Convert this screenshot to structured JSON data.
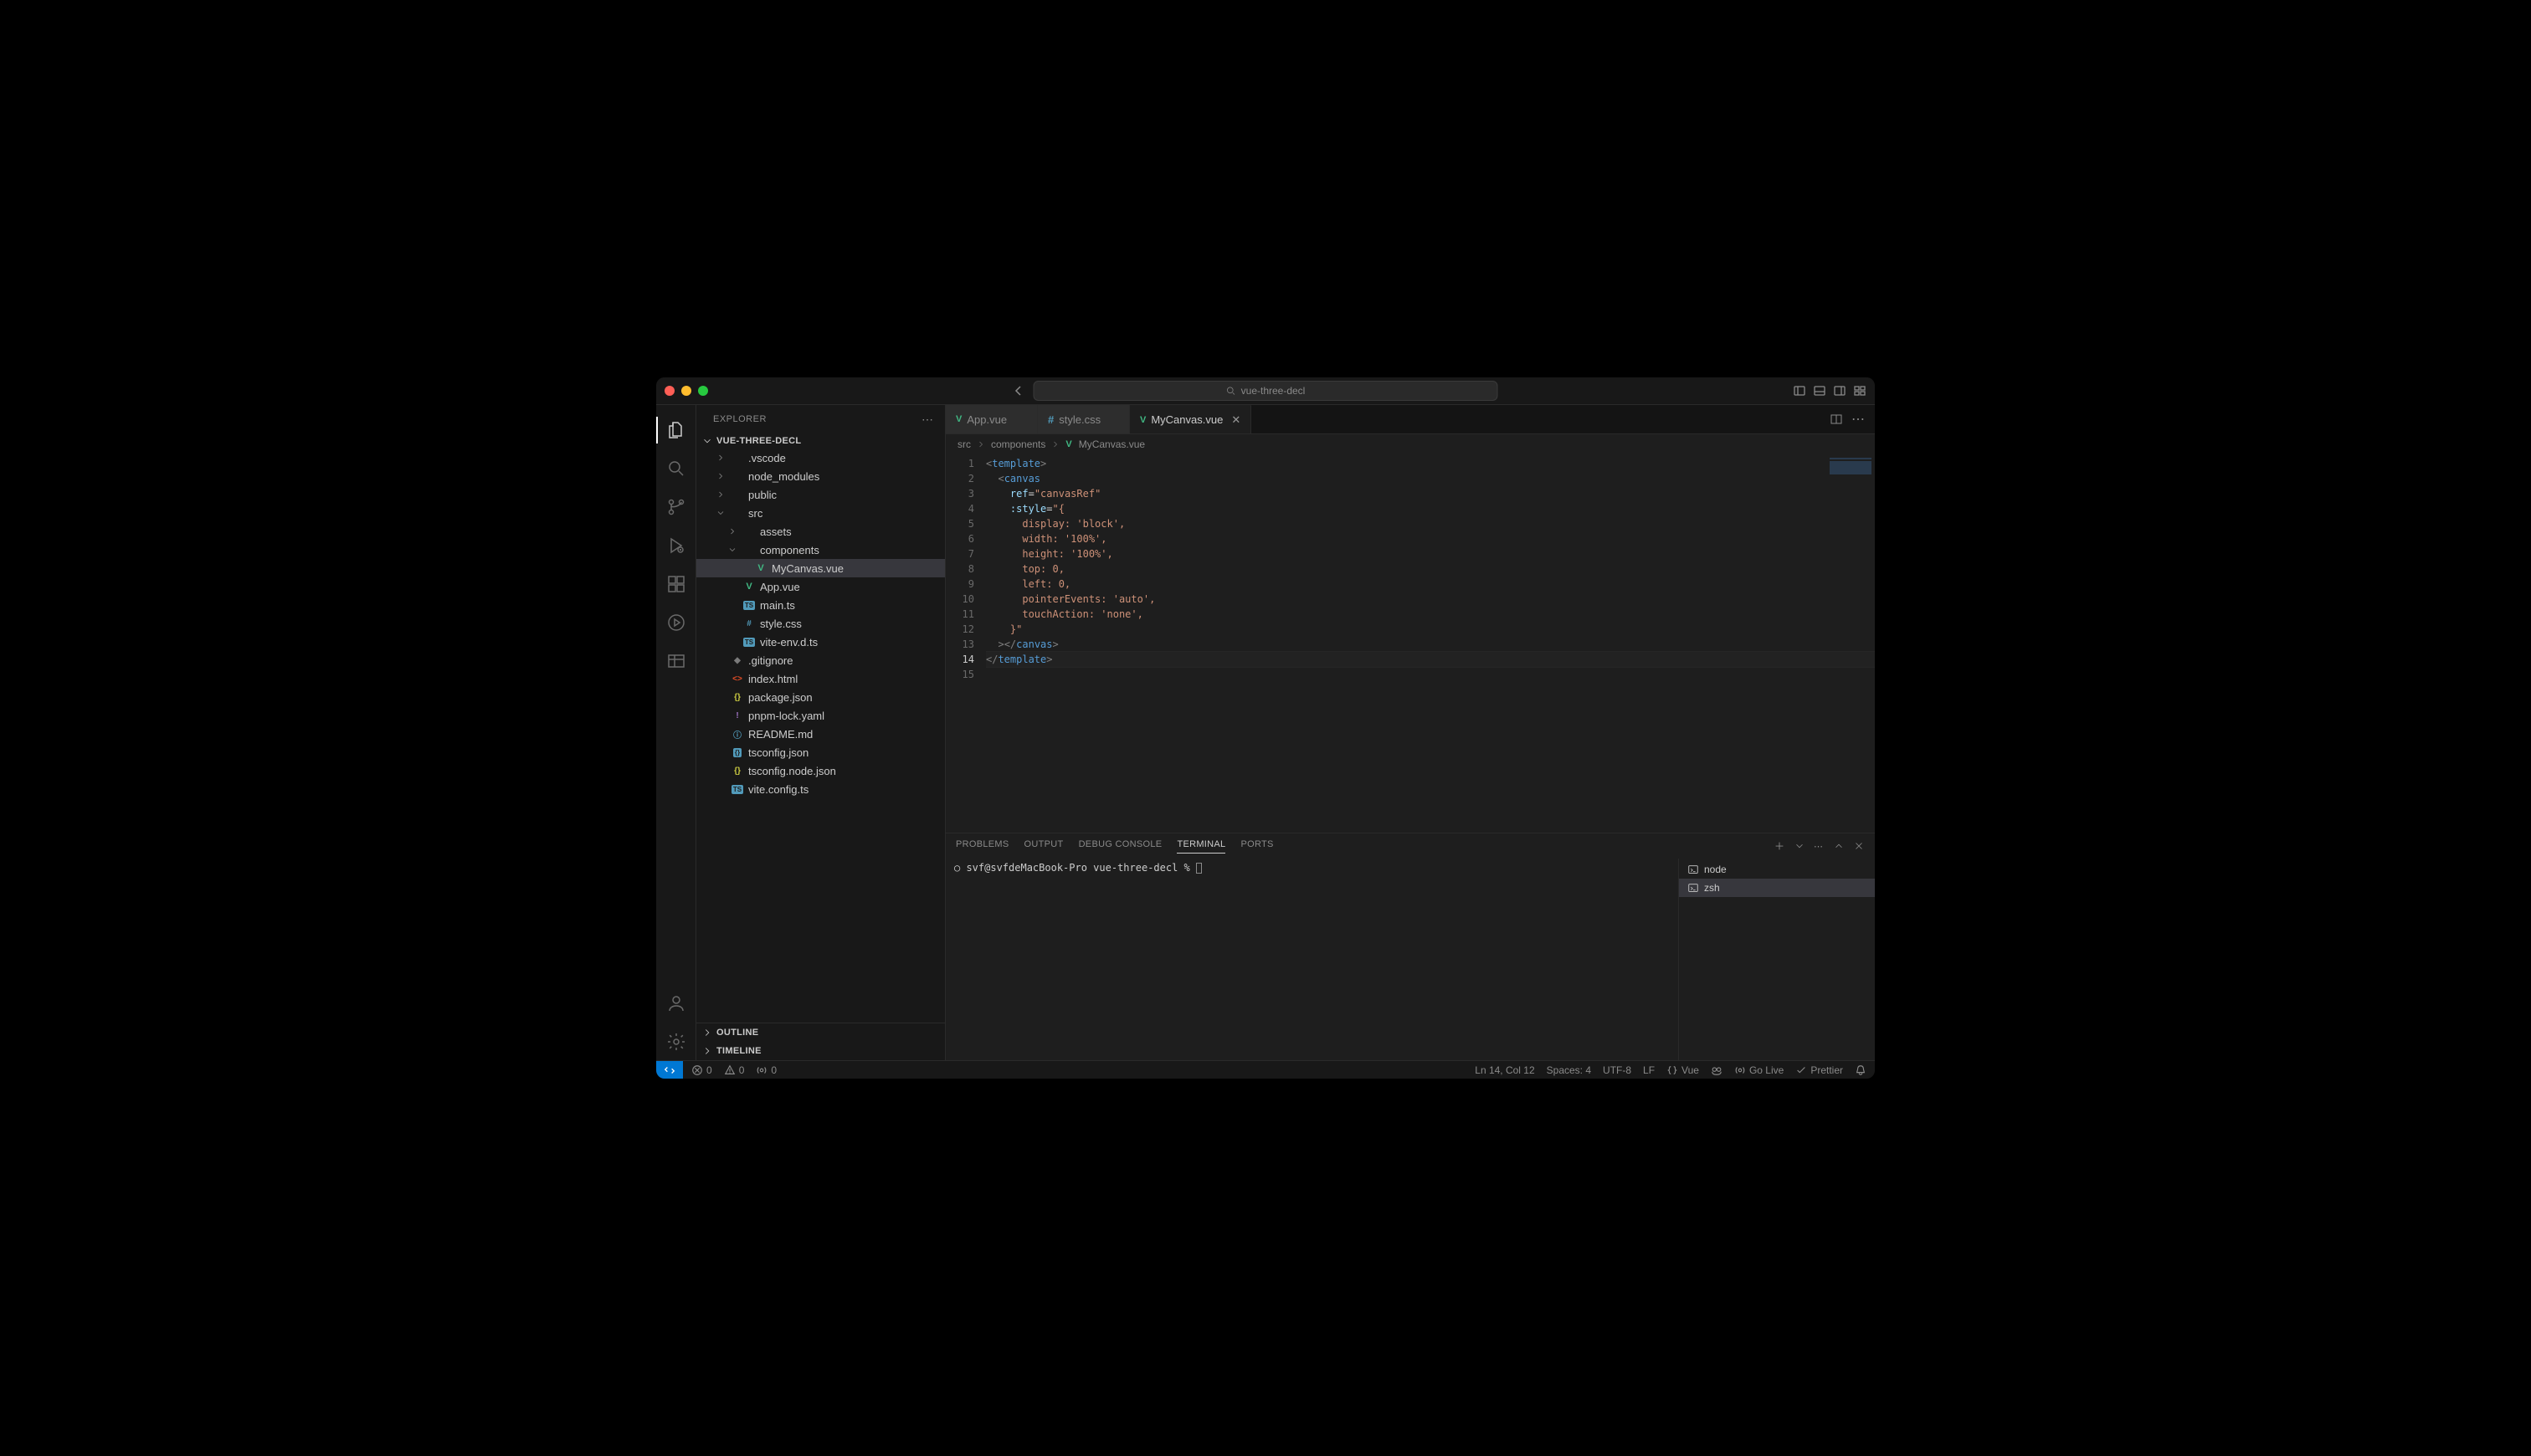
{
  "titlebar": {
    "search_text": "vue-three-decl"
  },
  "activitybar": {
    "items": [
      "explorer",
      "search",
      "scm",
      "run",
      "extensions",
      "live",
      "table"
    ],
    "bottom": [
      "accounts",
      "settings"
    ]
  },
  "sidebar": {
    "title": "EXPLORER",
    "project_name": "VUE-THREE-DECL",
    "files": [
      {
        "name": ".vscode",
        "type": "folder",
        "depth": 1,
        "open": false
      },
      {
        "name": "node_modules",
        "type": "folder",
        "depth": 1,
        "open": false
      },
      {
        "name": "public",
        "type": "folder",
        "depth": 1,
        "open": false
      },
      {
        "name": "src",
        "type": "folder",
        "depth": 1,
        "open": true
      },
      {
        "name": "assets",
        "type": "folder",
        "depth": 2,
        "open": false
      },
      {
        "name": "components",
        "type": "folder",
        "depth": 2,
        "open": true
      },
      {
        "name": "MyCanvas.vue",
        "type": "file",
        "depth": 3,
        "icon": "vue",
        "selected": true
      },
      {
        "name": "App.vue",
        "type": "file",
        "depth": 2,
        "icon": "vue"
      },
      {
        "name": "main.ts",
        "type": "file",
        "depth": 2,
        "icon": "ts"
      },
      {
        "name": "style.css",
        "type": "file",
        "depth": 2,
        "icon": "css"
      },
      {
        "name": "vite-env.d.ts",
        "type": "file",
        "depth": 2,
        "icon": "ts"
      },
      {
        "name": ".gitignore",
        "type": "file",
        "depth": 1,
        "icon": "git"
      },
      {
        "name": "index.html",
        "type": "file",
        "depth": 1,
        "icon": "html"
      },
      {
        "name": "package.json",
        "type": "file",
        "depth": 1,
        "icon": "json"
      },
      {
        "name": "pnpm-lock.yaml",
        "type": "file",
        "depth": 1,
        "icon": "yaml"
      },
      {
        "name": "README.md",
        "type": "file",
        "depth": 1,
        "icon": "info"
      },
      {
        "name": "tsconfig.json",
        "type": "file",
        "depth": 1,
        "icon": "tsjson"
      },
      {
        "name": "tsconfig.node.json",
        "type": "file",
        "depth": 1,
        "icon": "json"
      },
      {
        "name": "vite.config.ts",
        "type": "file",
        "depth": 1,
        "icon": "ts"
      }
    ],
    "outline_label": "OUTLINE",
    "timeline_label": "TIMELINE"
  },
  "tabs": [
    {
      "label": "App.vue",
      "icon": "vue",
      "active": false
    },
    {
      "label": "style.css",
      "icon": "css",
      "active": false
    },
    {
      "label": "MyCanvas.vue",
      "icon": "vue",
      "active": true,
      "close": true
    }
  ],
  "breadcrumb": {
    "parts": [
      "src",
      "components",
      "MyCanvas.vue"
    ]
  },
  "code": {
    "lines": [
      [
        {
          "t": "<",
          "c": "brkt"
        },
        {
          "t": "template",
          "c": "tag"
        },
        {
          "t": ">",
          "c": "brkt"
        }
      ],
      [
        {
          "t": "  ",
          "c": ""
        },
        {
          "t": "<",
          "c": "brkt"
        },
        {
          "t": "canvas",
          "c": "tag"
        }
      ],
      [
        {
          "t": "    ",
          "c": ""
        },
        {
          "t": "ref",
          "c": "attr"
        },
        {
          "t": "=",
          "c": "punct"
        },
        {
          "t": "\"canvasRef\"",
          "c": "str"
        }
      ],
      [
        {
          "t": "    ",
          "c": ""
        },
        {
          "t": ":style",
          "c": "attr"
        },
        {
          "t": "=",
          "c": "punct"
        },
        {
          "t": "\"{",
          "c": "str"
        }
      ],
      [
        {
          "t": "      ",
          "c": ""
        },
        {
          "t": "display: 'block',",
          "c": "str"
        }
      ],
      [
        {
          "t": "      ",
          "c": ""
        },
        {
          "t": "width: '100%',",
          "c": "str"
        }
      ],
      [
        {
          "t": "      ",
          "c": ""
        },
        {
          "t": "height: '100%',",
          "c": "str"
        }
      ],
      [
        {
          "t": "      ",
          "c": ""
        },
        {
          "t": "top: 0,",
          "c": "str"
        }
      ],
      [
        {
          "t": "      ",
          "c": ""
        },
        {
          "t": "left: 0,",
          "c": "str"
        }
      ],
      [
        {
          "t": "      ",
          "c": ""
        },
        {
          "t": "pointerEvents: 'auto',",
          "c": "str"
        }
      ],
      [
        {
          "t": "      ",
          "c": ""
        },
        {
          "t": "touchAction: 'none',",
          "c": "str"
        }
      ],
      [
        {
          "t": "    ",
          "c": ""
        },
        {
          "t": "}\"",
          "c": "str"
        }
      ],
      [
        {
          "t": "  ",
          "c": ""
        },
        {
          "t": ">",
          "c": "brkt"
        },
        {
          "t": "</",
          "c": "brkt"
        },
        {
          "t": "canvas",
          "c": "tag"
        },
        {
          "t": ">",
          "c": "brkt"
        }
      ],
      [
        {
          "t": "</",
          "c": "brkt"
        },
        {
          "t": "template",
          "c": "tag"
        },
        {
          "t": ">",
          "c": "brkt"
        }
      ],
      [
        {
          "t": "",
          "c": ""
        }
      ]
    ],
    "current_line": 14
  },
  "panel": {
    "tabs": [
      "PROBLEMS",
      "OUTPUT",
      "DEBUG CONSOLE",
      "TERMINAL",
      "PORTS"
    ],
    "active_tab": "TERMINAL",
    "prompt": "○ svf@svfdeMacBook-Pro vue-three-decl % ",
    "terminals": [
      {
        "name": "node",
        "active": false
      },
      {
        "name": "zsh",
        "active": true
      }
    ]
  },
  "status": {
    "errors": "0",
    "warnings": "0",
    "ports": "0",
    "ln_col": "Ln 14, Col 12",
    "spaces": "Spaces: 4",
    "encoding": "UTF-8",
    "eol": "LF",
    "lang": "Vue",
    "go_live": "Go Live",
    "prettier": "Prettier"
  }
}
